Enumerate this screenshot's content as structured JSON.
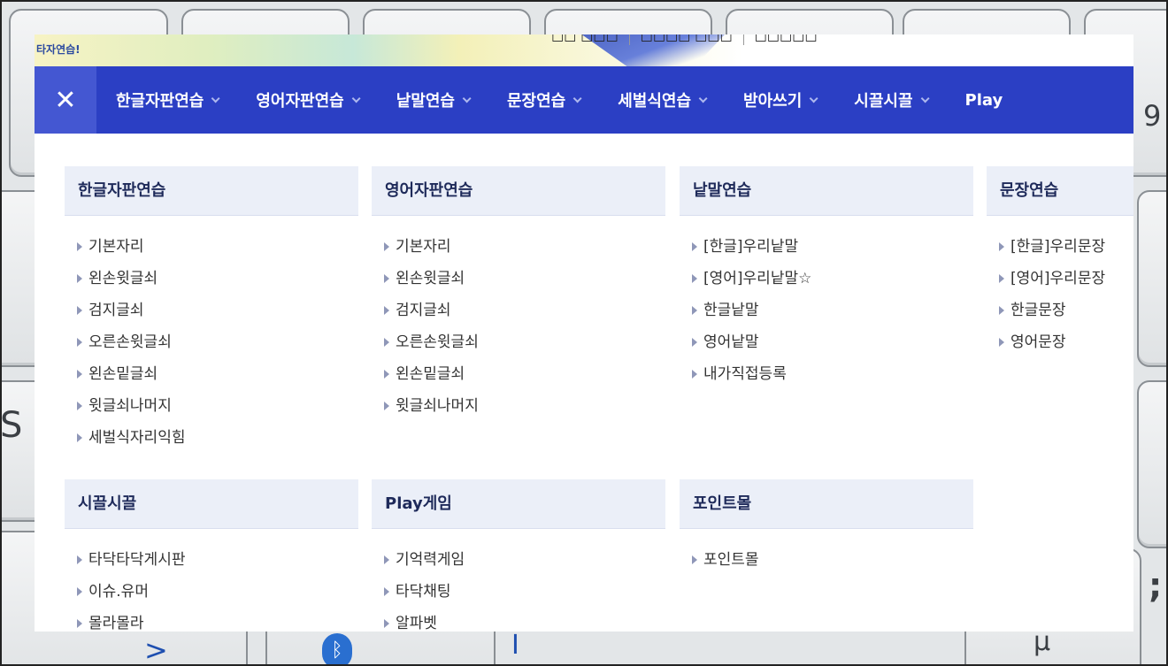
{
  "logo": {
    "text": "타자연습!"
  },
  "top_links": [
    "□□ □□□",
    "□□□□ □□□",
    "□□□□□"
  ],
  "nav": {
    "close_icon": "close-icon",
    "items": [
      {
        "label": "한글자판연습"
      },
      {
        "label": "영어자판연습"
      },
      {
        "label": "낱말연습"
      },
      {
        "label": "문장연습"
      },
      {
        "label": "세벌식연습"
      },
      {
        "label": "받아쓰기"
      },
      {
        "label": "시끌시끌"
      },
      {
        "label": "Play"
      }
    ]
  },
  "menu": {
    "columns": [
      {
        "title": "한글자판연습",
        "items": [
          "기본자리",
          "왼손윗글쇠",
          "검지글쇠",
          "오른손윗글쇠",
          "왼손밑글쇠",
          "윗글쇠나머지",
          "세벌식자리익힘"
        ]
      },
      {
        "title": "영어자판연습",
        "items": [
          "기본자리",
          "왼손윗글쇠",
          "검지글쇠",
          "오른손윗글쇠",
          "왼손밑글쇠",
          "윗글쇠나머지"
        ]
      },
      {
        "title": "낱말연습",
        "items": [
          "[한글]우리낱말",
          "[영어]우리낱말☆",
          "한글낱말",
          "영어낱말",
          "내가직접등록"
        ]
      },
      {
        "title": "문장연습",
        "items": [
          "[한글]우리문장",
          "[영어]우리문장",
          "한글문장",
          "영어문장"
        ]
      },
      {
        "title": "시끌시끌",
        "items": [
          "타닥타닥게시판",
          "이슈.유머",
          "몰라몰라"
        ]
      },
      {
        "title": "Play게임",
        "items": [
          "기억력게임",
          "타닥채팅",
          "알파벳"
        ]
      },
      {
        "title": "포인트몰",
        "items": [
          "포인트몰"
        ]
      }
    ]
  },
  "background_keys": {
    "glyphs": [
      "S",
      ">",
      "I",
      "μ",
      ";",
      "9"
    ]
  },
  "colors": {
    "nav_bg": "#2b3fc4",
    "close_bg": "#4457d2",
    "menu_header_bg": "#ebeff8",
    "menu_header_text": "#1e2a5a"
  }
}
